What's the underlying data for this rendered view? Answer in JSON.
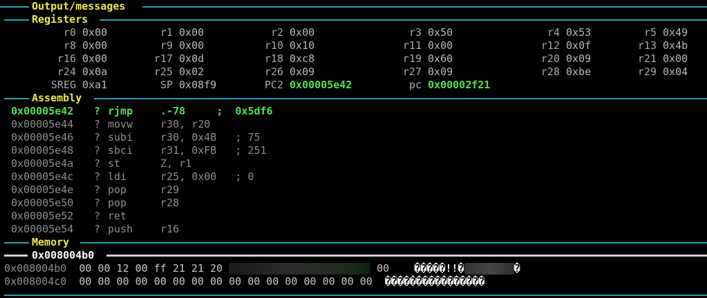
{
  "sections": {
    "output": "Output/messages",
    "registers": "Registers",
    "assembly": "Assembly",
    "memory": "Memory"
  },
  "registers": [
    [
      {
        "n": "r0",
        "v": "0x00"
      },
      {
        "n": "r1",
        "v": "0x00"
      },
      {
        "n": "r2",
        "v": "0x00"
      },
      {
        "n": "r3",
        "v": "0x50"
      },
      {
        "n": "r4",
        "v": "0x53"
      },
      {
        "n": "r5",
        "v": "0x49"
      }
    ],
    [
      {
        "n": "r8",
        "v": "0x00"
      },
      {
        "n": "r9",
        "v": "0x00"
      },
      {
        "n": "r10",
        "v": "0x10"
      },
      {
        "n": "r11",
        "v": "0x00"
      },
      {
        "n": "r12",
        "v": "0x0f"
      },
      {
        "n": "r13",
        "v": "0x4b"
      }
    ],
    [
      {
        "n": "r16",
        "v": "0x00"
      },
      {
        "n": "r17",
        "v": "0x0d"
      },
      {
        "n": "r18",
        "v": "0xc8"
      },
      {
        "n": "r19",
        "v": "0x60"
      },
      {
        "n": "r20",
        "v": "0x09"
      },
      {
        "n": "r21",
        "v": "0x00"
      }
    ],
    [
      {
        "n": "r24",
        "v": "0x0a"
      },
      {
        "n": "r25",
        "v": "0x02"
      },
      {
        "n": "r26",
        "v": "0x09"
      },
      {
        "n": "r27",
        "v": "0x09"
      },
      {
        "n": "r28",
        "v": "0xbe"
      },
      {
        "n": "r29",
        "v": "0x04"
      }
    ],
    [
      {
        "n": "SREG",
        "v": "0xa1"
      },
      {
        "n": "SP",
        "v": "0x08f9"
      },
      {
        "n": "PC2",
        "v": "0x00005e42",
        "hi": true
      },
      {
        "n": "pc",
        "v": "0x00002f21",
        "hi": true
      }
    ]
  ],
  "assembly": [
    {
      "addr": "0x00005e42",
      "mark": "?",
      "op": "rjmp",
      "args": "  .-78",
      "comment": "     ;  0x5df6",
      "current": true
    },
    {
      "addr": "0x00005e44",
      "mark": "?",
      "op": "movw",
      "args": "  r30, r20",
      "comment": ""
    },
    {
      "addr": "0x00005e46",
      "mark": "?",
      "op": "subi",
      "args": "  r30, 0x4B",
      "comment": "   ; 75"
    },
    {
      "addr": "0x00005e48",
      "mark": "?",
      "op": "sbci",
      "args": "  r31, 0xFB",
      "comment": "   ; 251"
    },
    {
      "addr": "0x00005e4a",
      "mark": "?",
      "op": "st",
      "args": "  Z, r1",
      "comment": ""
    },
    {
      "addr": "0x00005e4c",
      "mark": "?",
      "op": "ldi",
      "args": "  r25, 0x00",
      "comment": "   ; 0"
    },
    {
      "addr": "0x00005e4e",
      "mark": "?",
      "op": "pop",
      "args": "  r29",
      "comment": ""
    },
    {
      "addr": "0x00005e50",
      "mark": "?",
      "op": "pop",
      "args": "  r28",
      "comment": ""
    },
    {
      "addr": "0x00005e52",
      "mark": "?",
      "op": "ret",
      "args": "",
      "comment": ""
    },
    {
      "addr": "0x00005e54",
      "mark": "?",
      "op": "push",
      "args": "  r16",
      "comment": ""
    }
  ],
  "memory": {
    "base_label": "0x008004b0",
    "rows": [
      {
        "addr": "0x008004b0",
        "hex_left": "00 00 12 00 ff 21 21 20",
        "hex_right": "00",
        "ascii_left": "�����!!�",
        "ascii_right": "�"
      },
      {
        "addr": "0x008004c0",
        "hex_left": "00 00 00 00 00 00 00 00 00 00 00 00 00 00 00 00",
        "hex_right": "",
        "ascii_left": "����������������",
        "ascii_right": ""
      }
    ]
  }
}
